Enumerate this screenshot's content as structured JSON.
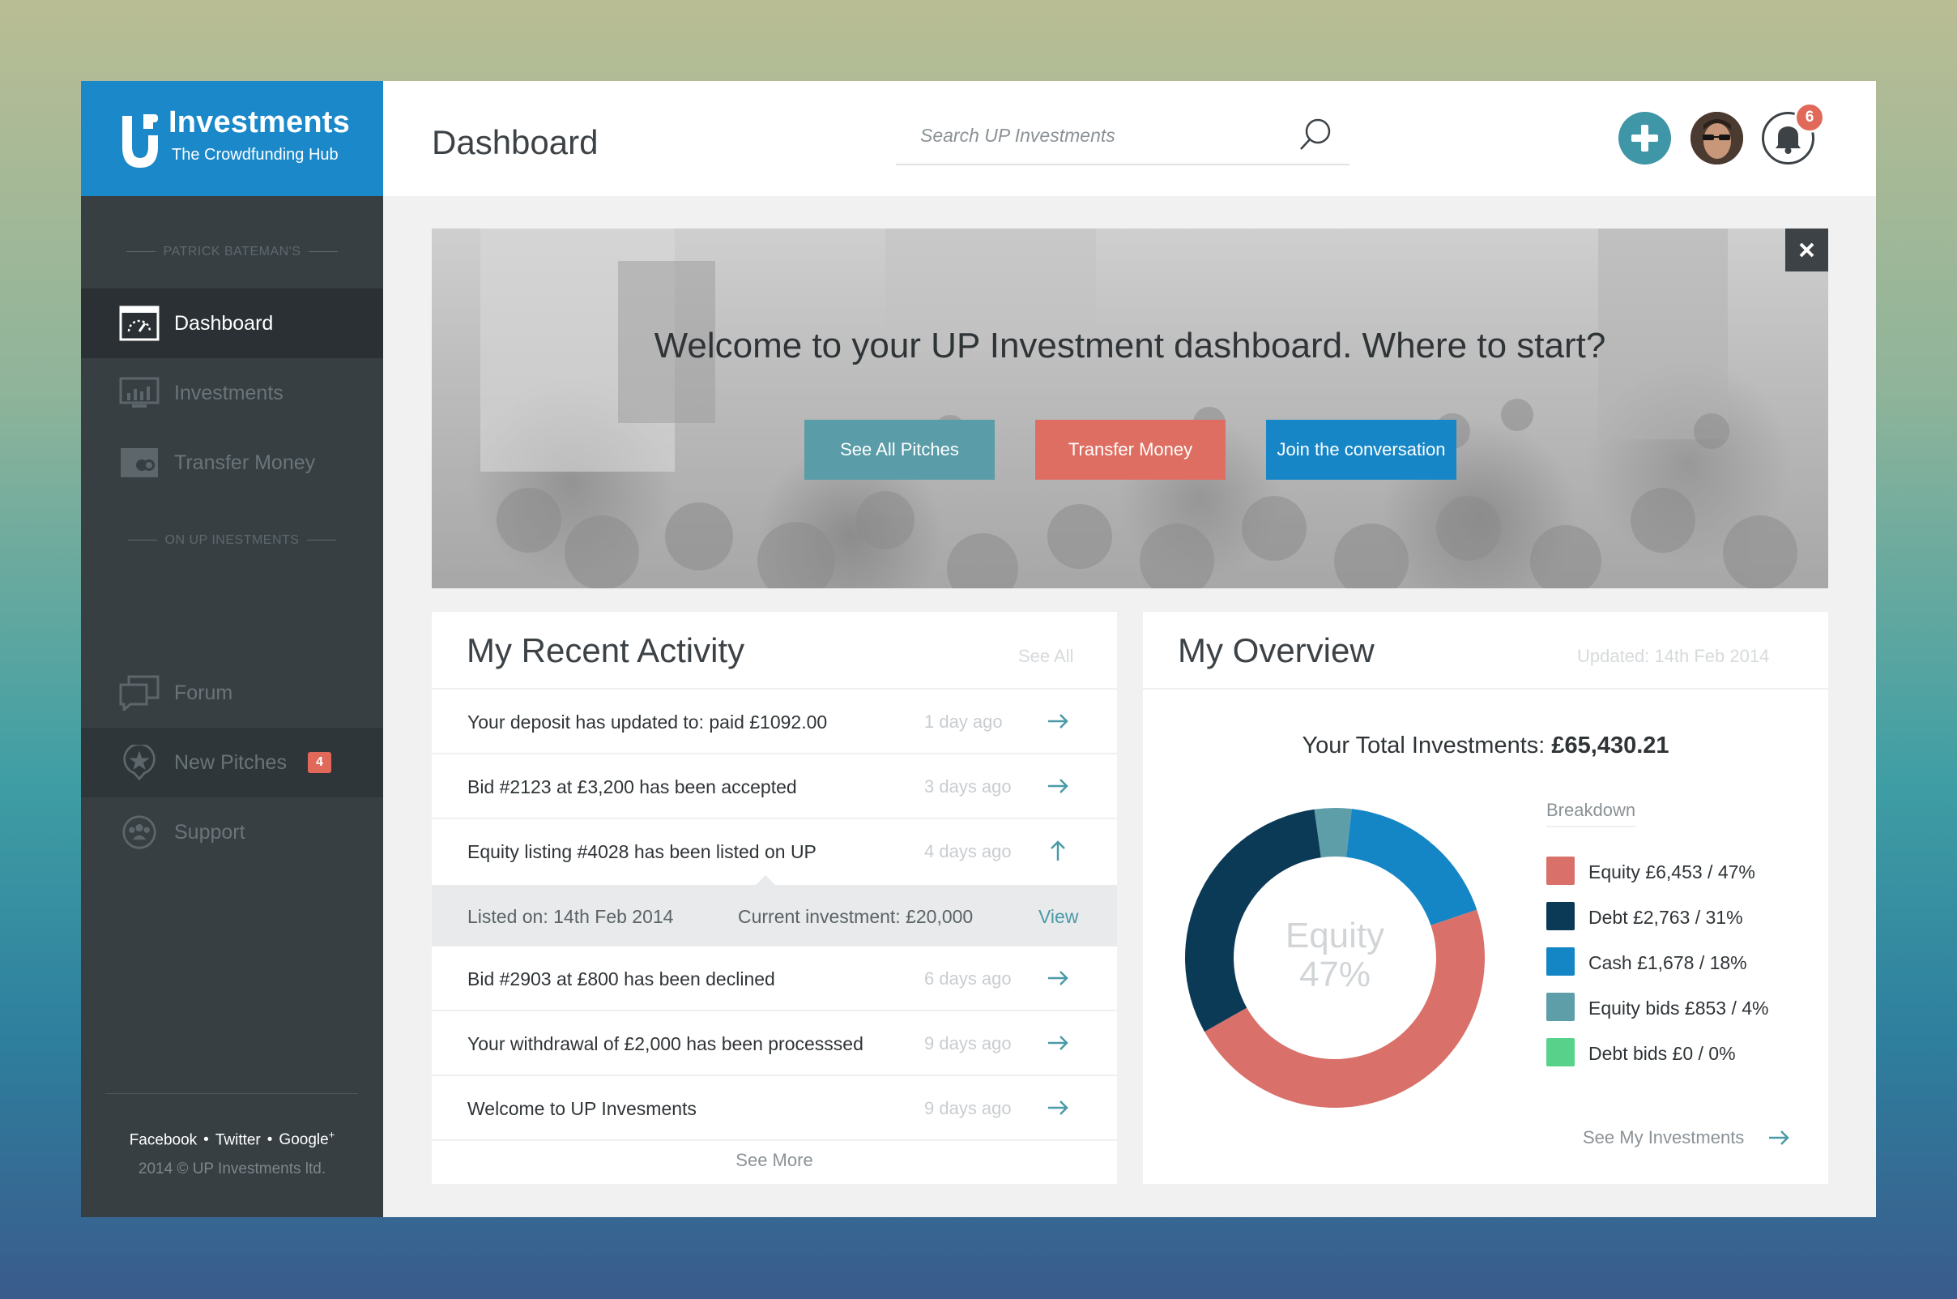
{
  "brand": {
    "name": "Investments",
    "tagline": "The Crowdfunding Hub"
  },
  "sidebar": {
    "section_user": "PATRICK BATEMAN'S",
    "section_site": "ON UP INESTMENTS",
    "items": [
      {
        "label": "Dashboard",
        "icon": "dashboard-icon"
      },
      {
        "label": "Investments",
        "icon": "investments-chart-icon"
      },
      {
        "label": "Transfer Money",
        "icon": "wallet-icon"
      },
      {
        "label": "Forum",
        "icon": "chat-bubbles-icon"
      },
      {
        "label": "New Pitches",
        "icon": "star-pin-icon",
        "badge": "4"
      },
      {
        "label": "Support",
        "icon": "support-people-icon"
      }
    ],
    "footer": {
      "facebook": "Facebook",
      "twitter": "Twitter",
      "google": "Google",
      "google_sup": "+",
      "copyright": "2014 © UP Investments ltd."
    }
  },
  "header": {
    "title": "Dashboard",
    "search_placeholder": "Search UP Investments",
    "notifications": "6"
  },
  "banner": {
    "title": "Welcome to your UP Investment dashboard. Where to start?",
    "buttons": {
      "pitches": "See All Pitches",
      "transfer": "Transfer Money",
      "join": "Join the conversation"
    }
  },
  "activity": {
    "title": "My Recent Activity",
    "see_all": "See All",
    "rows": [
      {
        "text": "Your deposit has updated to: paid £1092.00",
        "time": "1 day ago",
        "arrow": "right"
      },
      {
        "text": "Bid #2123 at £3,200 has been accepted",
        "time": "3 days ago",
        "arrow": "right"
      },
      {
        "text": "Equity listing #4028 has been listed on UP",
        "time": "4 days ago",
        "arrow": "up"
      },
      {
        "text": "Bid #2903 at £800 has been declined",
        "time": "6 days ago",
        "arrow": "right"
      },
      {
        "text": "Your withdrawal of £2,000 has been processsed",
        "time": "9 days ago",
        "arrow": "right"
      },
      {
        "text": "Welcome to UP Invesments",
        "time": "9 days ago",
        "arrow": "right"
      }
    ],
    "detail": {
      "listed": "Listed on: 14th Feb 2014",
      "current": "Current investment: £20,000",
      "view": "View"
    },
    "see_more": "See More"
  },
  "overview": {
    "title": "My Overview",
    "updated": "Updated: 14th Feb 2014",
    "total_label": "Your Total Investments:",
    "total_value": "£65,430.21",
    "center_line1": "Equity",
    "center_line2": "47%",
    "breakdown_label": "Breakdown",
    "legend": [
      {
        "label": "Equity £6,453 / 47%",
        "color": "#d9716a"
      },
      {
        "label": "Debt £2,763 / 31%",
        "color": "#0b3a57"
      },
      {
        "label": "Cash £1,678 / 18%",
        "color": "#1586c5"
      },
      {
        "label": "Equity bids £853 / 4%",
        "color": "#5e9ea9"
      },
      {
        "label": "Debt bids £0 / 0%",
        "color": "#58d28a"
      }
    ],
    "see_investments": "See My Investments"
  },
  "chart_data": {
    "type": "pie",
    "categories": [
      "Equity",
      "Debt",
      "Cash",
      "Equity bids",
      "Debt bids"
    ],
    "values": [
      47,
      31,
      18,
      4,
      0
    ],
    "colors": [
      "#d9716a",
      "#0b3a57",
      "#1586c5",
      "#5e9ea9",
      "#58d28a"
    ]
  }
}
